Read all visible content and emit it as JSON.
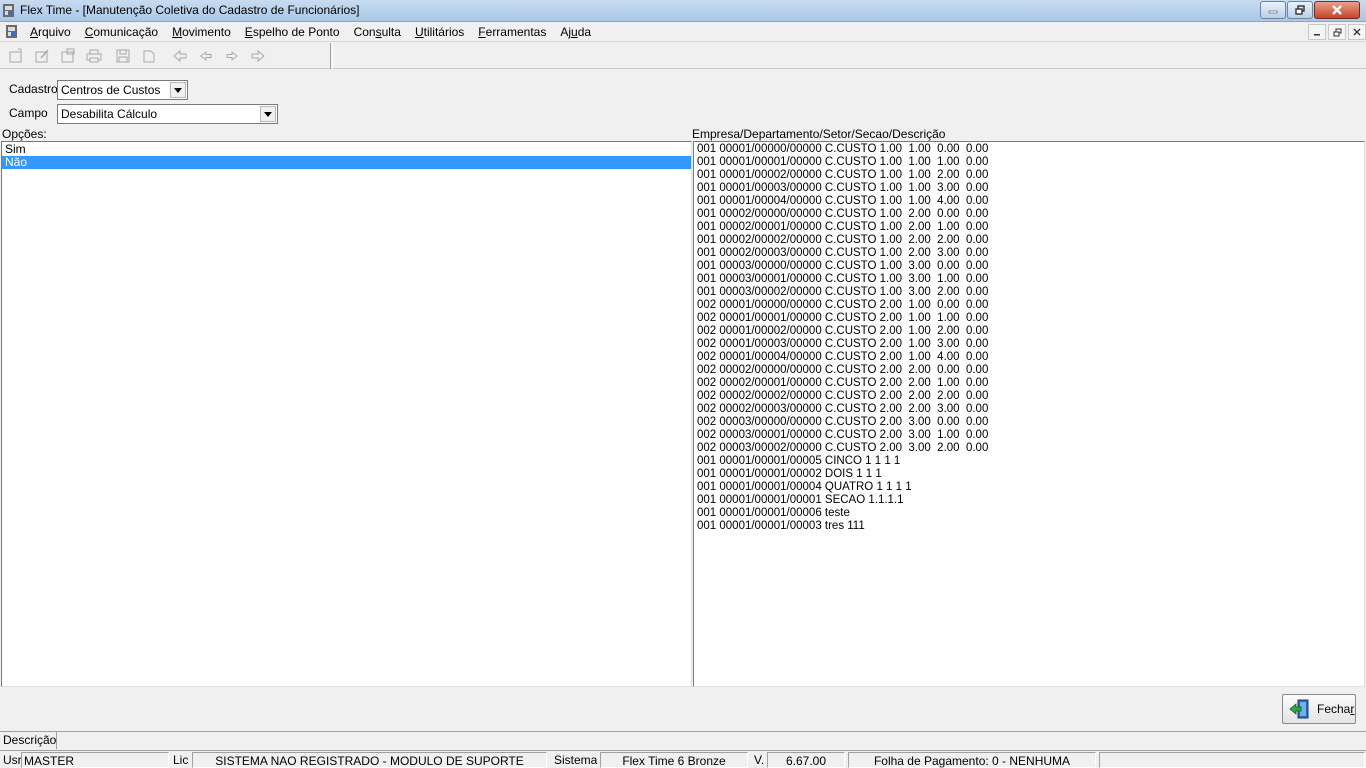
{
  "window": {
    "title": "Flex Time - [Manutenção Coletiva do Cadastro de Funcionários]"
  },
  "menu": [
    {
      "before": "",
      "ul": "A",
      "after": "rquivo"
    },
    {
      "before": "",
      "ul": "C",
      "after": "omunicação"
    },
    {
      "before": "",
      "ul": "M",
      "after": "ovimento"
    },
    {
      "before": "",
      "ul": "E",
      "after": "spelho de Ponto"
    },
    {
      "before": "Con",
      "ul": "s",
      "after": "ulta"
    },
    {
      "before": "",
      "ul": "U",
      "after": "tilitários"
    },
    {
      "before": "",
      "ul": "F",
      "after": "erramentas"
    },
    {
      "before": "Aj",
      "ul": "u",
      "after": "da"
    }
  ],
  "form": {
    "cadastro_label": "Cadastro:",
    "cadastro_value": "Centros de Custos",
    "campo_label": "Campo",
    "campo_value": "Desabilita Cálculo",
    "opcoes_label": "Opções:",
    "empresa_label": "Empresa/Departamento/Setor/Secao/Descrição"
  },
  "options": [
    {
      "label": "Sim",
      "selected": false
    },
    {
      "label": "Não",
      "selected": true
    }
  ],
  "cost_centers": [
    "001 00001/00000/00000 C.CUSTO 1.00  1.00  0.00  0.00",
    "001 00001/00001/00000 C.CUSTO 1.00  1.00  1.00  0.00",
    "001 00001/00002/00000 C.CUSTO 1.00  1.00  2.00  0.00",
    "001 00001/00003/00000 C.CUSTO 1.00  1.00  3.00  0.00",
    "001 00001/00004/00000 C.CUSTO 1.00  1.00  4.00  0.00",
    "001 00002/00000/00000 C.CUSTO 1.00  2.00  0.00  0.00",
    "001 00002/00001/00000 C.CUSTO 1.00  2.00  1.00  0.00",
    "001 00002/00002/00000 C.CUSTO 1.00  2.00  2.00  0.00",
    "001 00002/00003/00000 C.CUSTO 1.00  2.00  3.00  0.00",
    "001 00003/00000/00000 C.CUSTO 1.00  3.00  0.00  0.00",
    "001 00003/00001/00000 C.CUSTO 1.00  3.00  1.00  0.00",
    "001 00003/00002/00000 C.CUSTO 1.00  3.00  2.00  0.00",
    "002 00001/00000/00000 C.CUSTO 2.00  1.00  0.00  0.00",
    "002 00001/00001/00000 C.CUSTO 2.00  1.00  1.00  0.00",
    "002 00001/00002/00000 C.CUSTO 2.00  1.00  2.00  0.00",
    "002 00001/00003/00000 C.CUSTO 2.00  1.00  3.00  0.00",
    "002 00001/00004/00000 C.CUSTO 2.00  1.00  4.00  0.00",
    "002 00002/00000/00000 C.CUSTO 2.00  2.00  0.00  0.00",
    "002 00002/00001/00000 C.CUSTO 2.00  2.00  1.00  0.00",
    "002 00002/00002/00000 C.CUSTO 2.00  2.00  2.00  0.00",
    "002 00002/00003/00000 C.CUSTO 2.00  2.00  3.00  0.00",
    "002 00003/00000/00000 C.CUSTO 2.00  3.00  0.00  0.00",
    "002 00003/00001/00000 C.CUSTO 2.00  3.00  1.00  0.00",
    "002 00003/00002/00000 C.CUSTO 2.00  3.00  2.00  0.00",
    "001 00001/00001/00005 CINCO 1 1 1 1",
    "001 00001/00001/00002 DOIS 1 1 1",
    "001 00001/00001/00004 QUATRO 1 1 1 1",
    "001 00001/00001/00001 SECAO 1.1.1.1",
    "001 00001/00001/00006 teste",
    "001 00001/00001/00003 tres 111"
  ],
  "buttons": {
    "fechar_before": "Fecha",
    "fechar_ul": "r"
  },
  "descricao_label": "Descrição",
  "status": {
    "usr_label": "Usr",
    "usr_value": "MASTER",
    "lic_label": "Lic",
    "lic_value": "SISTEMA NAO REGISTRADO - MODULO DE SUPORTE",
    "sistema_label": "Sistema",
    "sistema_value": "Flex Time 6 Bronze",
    "version_label": "V.",
    "version_value": "6.67.00",
    "folha_value": "Folha de Pagamento: 0 - NENHUMA"
  },
  "colors": {
    "selection": "#3399ff",
    "titlebar": "#aac8e8",
    "close_button": "#c7452b"
  }
}
